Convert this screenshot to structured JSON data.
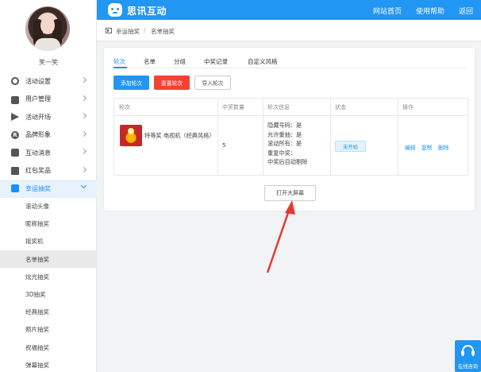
{
  "user": {
    "name": "笑一笑"
  },
  "sidebar": {
    "items": [
      {
        "label": "活动设置",
        "icon": "gear-icon"
      },
      {
        "label": "用户管理",
        "icon": "lock-icon"
      },
      {
        "label": "活动开场",
        "icon": "send-icon"
      },
      {
        "label": "品牌形象",
        "icon": "brand-icon"
      },
      {
        "label": "互动消息",
        "icon": "chat-icon"
      },
      {
        "label": "红包奖品",
        "icon": "gift-icon"
      },
      {
        "label": "幸运抽奖",
        "icon": "lucky-draw-icon"
      }
    ],
    "sub_items": [
      {
        "label": "滚动头像"
      },
      {
        "label": "昵称抽奖"
      },
      {
        "label": "摇奖机"
      },
      {
        "label": "名单抽奖"
      },
      {
        "label": "炫光抽奖"
      },
      {
        "label": "3D抽奖"
      },
      {
        "label": "经典抽奖"
      },
      {
        "label": "照片抽奖"
      },
      {
        "label": "祝福抽奖"
      },
      {
        "label": "弹幕抽奖"
      }
    ]
  },
  "topbar": {
    "brand": "思讯互动",
    "links": {
      "home": "网站首页",
      "help": "使用帮助",
      "back": "返回"
    }
  },
  "breadcrumb": {
    "parent": "幸运抽奖",
    "separator": "/",
    "current": "名单抽奖"
  },
  "tabs": [
    "轮次",
    "名单",
    "分组",
    "中奖记录",
    "自定义风格"
  ],
  "actions": {
    "add": "添加轮次",
    "reset": "重置轮次",
    "import": "导入轮次"
  },
  "table": {
    "headers": [
      "轮次",
      "中奖数量",
      "轮次信息",
      "状态",
      "操作"
    ],
    "rows": [
      {
        "prize": "特等奖 电视机（经典风格）",
        "count": "5",
        "info": [
          "隐藏号码：是",
          "允许重抽：是",
          "滚动所有：是",
          "重复中奖：",
          "中奖后自动剔除"
        ],
        "status": "未开始",
        "ops": [
          "编辑",
          "复制",
          "删除"
        ]
      }
    ]
  },
  "big_screen_button": "打开大屏幕",
  "float_help": {
    "label": "在线咨询"
  },
  "colors": {
    "primary": "#2196f3",
    "danger": "#f44336",
    "arrow": "#e53935"
  }
}
